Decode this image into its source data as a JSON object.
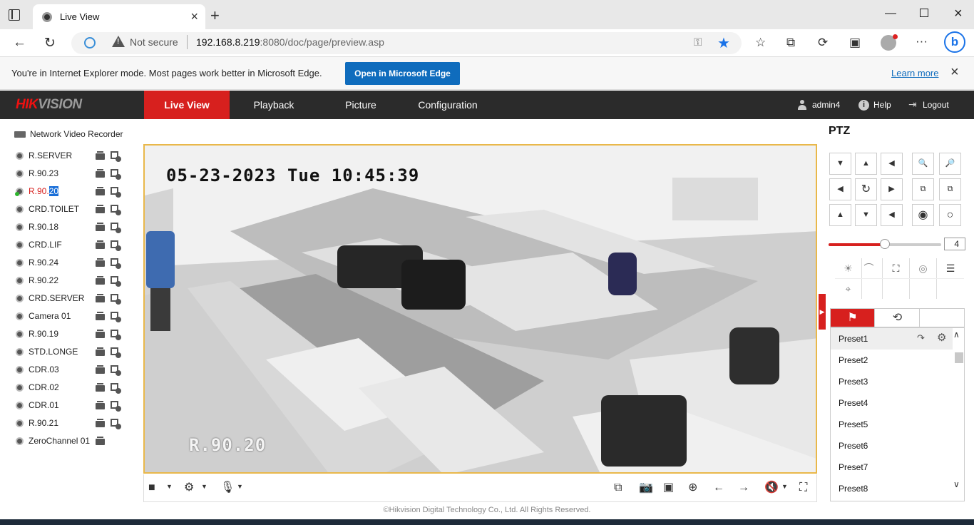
{
  "browser": {
    "tab_title": "Live View",
    "not_secure": "Not secure",
    "url_host": "192.168.8.219",
    "url_rest": ":8080/doc/page/preview.asp",
    "infobar_text": "You're in Internet Explorer mode. Most pages work better in Microsoft Edge.",
    "open_edge": "Open in Microsoft Edge",
    "learn_more": "Learn more"
  },
  "nav": {
    "logo_red": "HIK",
    "logo_gray": "VISION",
    "tabs": [
      "Live View",
      "Playback",
      "Picture",
      "Configuration"
    ],
    "active_tab": "Live View",
    "user": "admin4",
    "help": "Help",
    "logout": "Logout"
  },
  "device_tree": {
    "root": "Network Video Recorder",
    "cameras": [
      {
        "label": "R.SERVER"
      },
      {
        "label": "R.90.23"
      },
      {
        "label_prefix": "R.90.",
        "label_selected": "20",
        "active": true
      },
      {
        "label": "CRD.TOILET"
      },
      {
        "label": "R.90.18"
      },
      {
        "label": "CRD.LIF"
      },
      {
        "label": "R.90.24"
      },
      {
        "label": "R.90.22"
      },
      {
        "label": "CRD.SERVER"
      },
      {
        "label": "Camera 01"
      },
      {
        "label": "R.90.19"
      },
      {
        "label": "STD.LONGE"
      },
      {
        "label": "CDR.03"
      },
      {
        "label": "CDR.02"
      },
      {
        "label": "CDR.01"
      },
      {
        "label": "R.90.21"
      },
      {
        "label": "ZeroChannel 01"
      }
    ]
  },
  "video": {
    "osd_timestamp": "05-23-2023 Tue 10:45:39",
    "osd_camera_name": "R.90.20"
  },
  "ptz": {
    "title": "PTZ",
    "speed": "4",
    "speed_level_fraction": 0.5,
    "tabs": [
      "preset-flag",
      "patrol"
    ],
    "presets": [
      "Preset1",
      "Preset2",
      "Preset3",
      "Preset4",
      "Preset5",
      "Preset6",
      "Preset7",
      "Preset8"
    ],
    "selected_preset": "Preset1"
  },
  "footer": "©Hikvision Digital Technology Co., Ltd. All Rights Reserved.",
  "colors": {
    "accent": "#d7201e",
    "video_border": "#e9b84a",
    "edge_blue": "#0f6cbd"
  }
}
